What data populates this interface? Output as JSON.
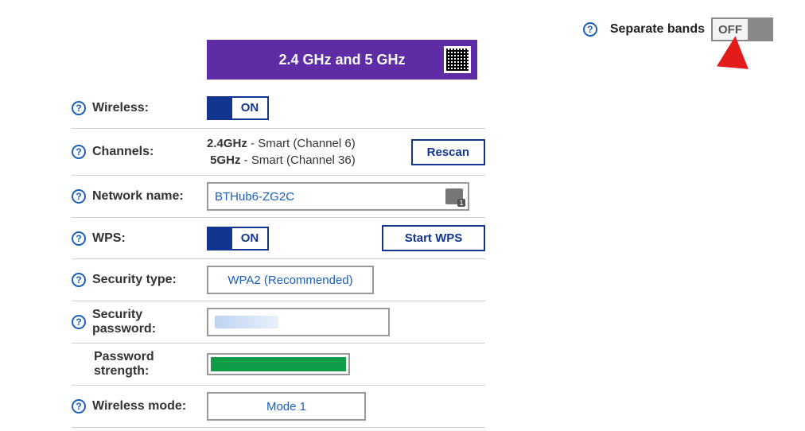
{
  "separate_bands": {
    "label": "Separate bands",
    "state": "OFF"
  },
  "band_header": "2.4 GHz and 5 GHz",
  "wireless": {
    "label": "Wireless:",
    "state": "ON"
  },
  "channels": {
    "label": "Channels:",
    "band1_name": "2.4GHz",
    "band1_value": " - Smart (Channel 6)",
    "band2_name": "5GHz",
    "band2_value": " - Smart (Channel 36)",
    "rescan_label": "Rescan"
  },
  "network_name": {
    "label": "Network name:",
    "value": "BTHub6-ZG2C"
  },
  "wps": {
    "label": "WPS:",
    "state": "ON",
    "start_label": "Start WPS"
  },
  "security_type": {
    "label": "Security type:",
    "value": "WPA2 (Recommended)"
  },
  "security_password": {
    "label": "Security password:"
  },
  "password_strength": {
    "label": "Password strength:"
  },
  "wireless_mode": {
    "label": "Wireless mode:",
    "value": "Mode 1"
  }
}
